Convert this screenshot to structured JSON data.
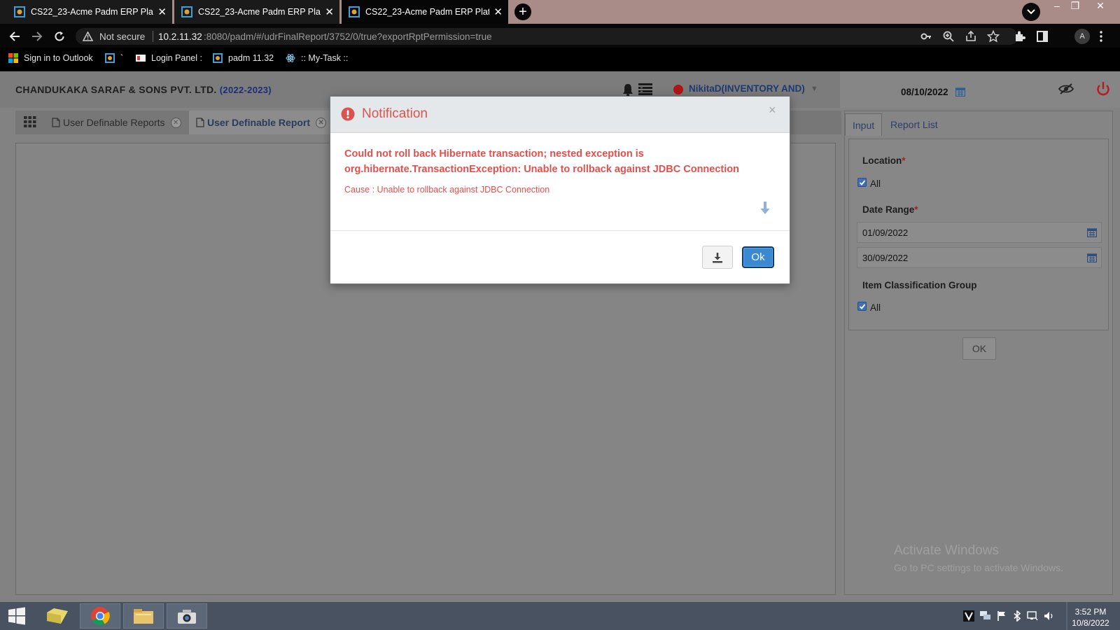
{
  "browser": {
    "tabs": [
      {
        "title": "CS22_23-Acme Padm ERP Platform",
        "state": "inactive"
      },
      {
        "title": "CS22_23-Acme Padm ERP Platform",
        "state": "inactive"
      },
      {
        "title": "CS22_23-Acme Padm ERP Platform",
        "state": "active"
      }
    ],
    "security_label": "Not secure",
    "url_host": "10.2.11.32",
    "url_rest": ":8080/padm/#/udrFinalReport/3752/0/true?exportRptPermission=true",
    "profile_initial": "A",
    "bookmarks": [
      {
        "label": "Sign in to Outlook",
        "icon": "windows-logo-icon"
      },
      {
        "label": "`",
        "icon": "app-favicon-icon"
      },
      {
        "label": "Login Panel :",
        "icon": "login-favicon-icon"
      },
      {
        "label": "padm 11.32",
        "icon": "app-favicon-icon"
      },
      {
        "label": ":: My-Task ::",
        "icon": "react-logo-icon"
      }
    ]
  },
  "app": {
    "company": "CHANDUKAKA SARAF & SONS PVT. LTD.",
    "year": "(2022-2023)",
    "user": "NikitaD(INVENTORY AND)",
    "system_date": "08/10/2022",
    "tabs": [
      {
        "label": "User Definable Reports"
      },
      {
        "label": "User Definable Report"
      }
    ]
  },
  "panel": {
    "tabs": [
      "Input",
      "Report List"
    ],
    "location_label": "Location",
    "location_all": "All",
    "date_range_label": "Date Range",
    "from_date": "01/09/2022",
    "to_date": "30/09/2022",
    "item_group_label": "Item Classification Group",
    "item_group_all": "All",
    "ok_label": "OK"
  },
  "watermark": {
    "title": "Activate Windows",
    "subtitle": "Go to PC settings to activate Windows."
  },
  "modal": {
    "title": "Notification",
    "close": "×",
    "error_line1": "Could not roll back Hibernate transaction; nested exception is",
    "error_line2": "org.hibernate.TransactionException: Unable to rollback against JDBC Connection",
    "cause": "Cause : Unable to rollback against JDBC Connection",
    "ok_label": "Ok"
  },
  "taskbar": {
    "time": "3:52 PM",
    "date": "10/8/2022"
  },
  "colors": {
    "error": "#e2504c",
    "primary_button": "#3a8ad3",
    "link": "#1d3a70",
    "checkbox": "#3f6fb8"
  }
}
